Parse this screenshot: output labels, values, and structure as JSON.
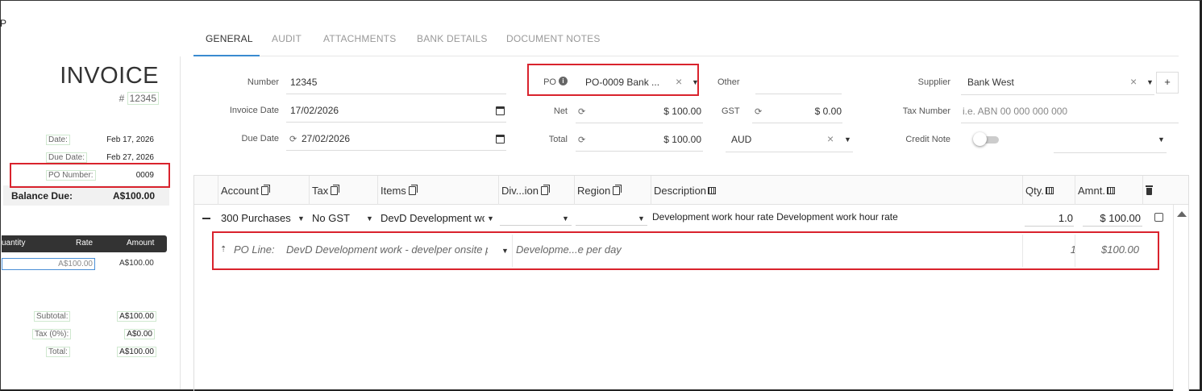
{
  "stray_char": "P",
  "tabs": [
    "GENERAL",
    "AUDIT",
    "ATTACHMENTS",
    "BANK DETAILS",
    "DOCUMENT NOTES"
  ],
  "preview": {
    "title": "INVOICE",
    "number_prefix": "#",
    "number": "12345",
    "date_label": "Date:",
    "date_value": "Feb 17, 2026",
    "due_label": "Due Date:",
    "due_value": "Feb 27, 2026",
    "po_label": "PO Number:",
    "po_value": "0009",
    "balance_label": "Balance Due:",
    "balance_value": "A$100.00",
    "col_quantity": "uantity",
    "col_rate": "Rate",
    "col_amount": "Amount",
    "rate_value": "A$100.00",
    "amount_value": "A$100.00",
    "subtotal_label": "Subtotal:",
    "subtotal_value": "A$100.00",
    "tax_label": "Tax (0%):",
    "tax_value": "A$0.00",
    "total_label": "Total:",
    "total_value": "A$100.00"
  },
  "form": {
    "number_label": "Number",
    "number_value": "12345",
    "invoice_date_label": "Invoice Date",
    "invoice_date_value": "17/02/2026",
    "due_date_label": "Due Date",
    "due_date_value": "27/02/2026",
    "po_label": "PO",
    "po_value": "PO-0009 Bank ...",
    "net_label": "Net",
    "net_value": "$ 100.00",
    "total_label": "Total",
    "total_value": "$ 100.00",
    "other_label": "Other",
    "gst_label": "GST",
    "gst_value": "$ 0.00",
    "currency_value": "AUD",
    "supplier_label": "Supplier",
    "supplier_value": "Bank West",
    "tax_number_label": "Tax Number",
    "tax_number_placeholder": "i.e. ABN 00 000 000 000",
    "credit_note_label": "Credit Note",
    "add_label": "+"
  },
  "grid": {
    "headers": {
      "account": "Account",
      "tax": "Tax",
      "items": "Items",
      "division": "Div...ion",
      "region": "Region",
      "description": "Description",
      "qty": "Qty.",
      "amount": "Amnt."
    },
    "row": {
      "account": "300 Purchases",
      "tax": "No GST",
      "items": "DevD Development wc",
      "description": "Development work hour rate Development work hour rate",
      "qty": "1.0",
      "amount": "$ 100.00"
    },
    "po_line": {
      "label": "PO Line:",
      "item": "DevD Development work - develper onsite pe",
      "description": "Developme...e per day",
      "qty": "1",
      "amount": "$100.00"
    }
  },
  "colors": {
    "accent": "#3a8bd0",
    "highlight": "#d9232d",
    "preview_header_bg": "#333333"
  }
}
